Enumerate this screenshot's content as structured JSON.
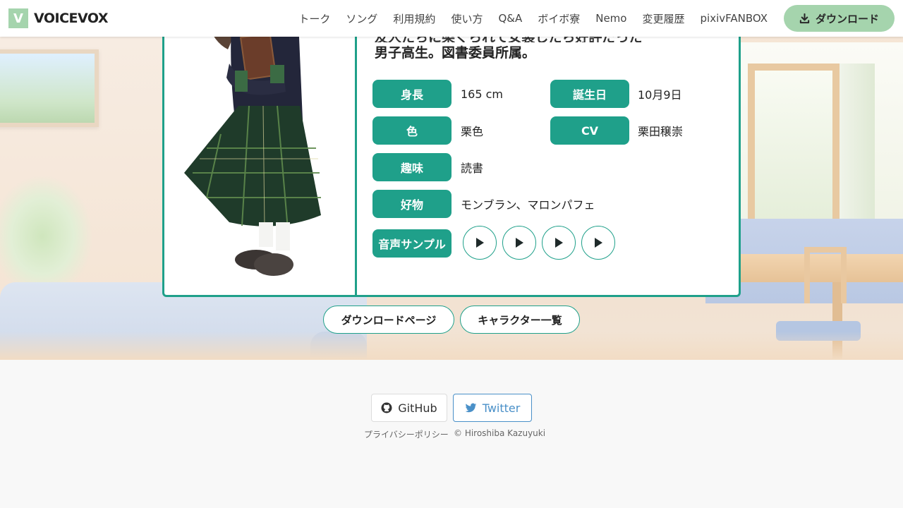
{
  "header": {
    "logo_letter": "V",
    "logo_text": "VOICEVOX",
    "nav": [
      "トーク",
      "ソング",
      "利用規約",
      "使い方",
      "Q&A",
      "ボイボ寮",
      "Nemo",
      "変更履歴",
      "pixivFANBOX"
    ],
    "download_label": "ダウンロード"
  },
  "character": {
    "description_line1": "友人たちに染ぐられて女装したら好評だった",
    "description_line2": "男子高生。図書委員所属。",
    "height_label": "身長",
    "height_value": "165 cm",
    "birthday_label": "誕生日",
    "birthday_value": "10月9日",
    "color_label": "色",
    "color_value": "栗色",
    "cv_label": "CV",
    "cv_value": "栗田穣崇",
    "hobby_label": "趣味",
    "hobby_value": "読書",
    "favorite_label": "好物",
    "favorite_value": "モンブラン、マロンパフェ",
    "sample_label": "音声サンプル"
  },
  "links": {
    "download_page": "ダウンロードページ",
    "character_list": "キャラクター一覧"
  },
  "footer": {
    "github": "GitHub",
    "twitter": "Twitter",
    "privacy": "プライバシーポリシー",
    "copyright": "© Hiroshiba Kazuyuki"
  },
  "colors": {
    "accent": "#1fa08a",
    "brand_light": "#a5d4ad",
    "twitter": "#4a90c8"
  },
  "icons": [
    "download-icon",
    "play-icon",
    "github-icon",
    "twitter-icon"
  ]
}
